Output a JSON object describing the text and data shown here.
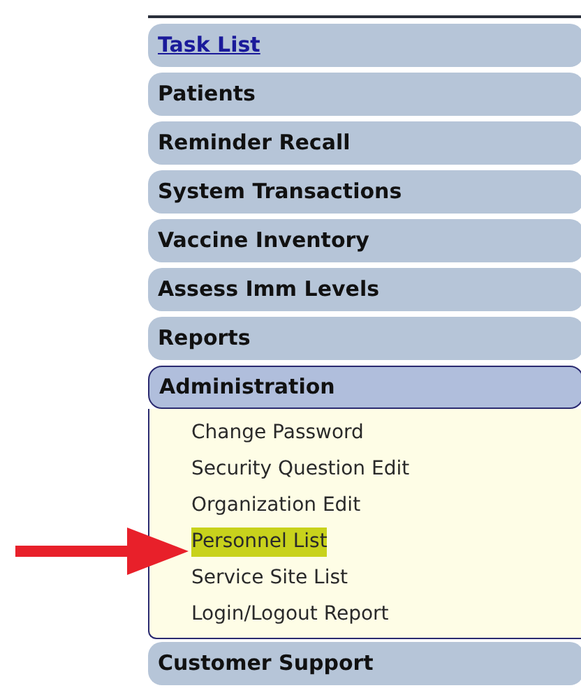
{
  "menu": {
    "items": [
      {
        "label": "Task List",
        "kind": "link"
      },
      {
        "label": "Patients",
        "kind": "section"
      },
      {
        "label": "Reminder Recall",
        "kind": "section"
      },
      {
        "label": "System Transactions",
        "kind": "section"
      },
      {
        "label": "Vaccine Inventory",
        "kind": "section"
      },
      {
        "label": "Assess Imm Levels",
        "kind": "section"
      },
      {
        "label": "Reports",
        "kind": "section"
      },
      {
        "label": "Administration",
        "kind": "section",
        "expanded": true,
        "children": [
          {
            "label": "Change Password",
            "selected": false
          },
          {
            "label": "Security Question Edit",
            "selected": false
          },
          {
            "label": "Organization Edit",
            "selected": false
          },
          {
            "label": "Personnel List",
            "selected": true
          },
          {
            "label": "Service Site List",
            "selected": false
          },
          {
            "label": "Login/Logout Report",
            "selected": false
          }
        ]
      },
      {
        "label": "Customer Support",
        "kind": "section"
      }
    ]
  }
}
